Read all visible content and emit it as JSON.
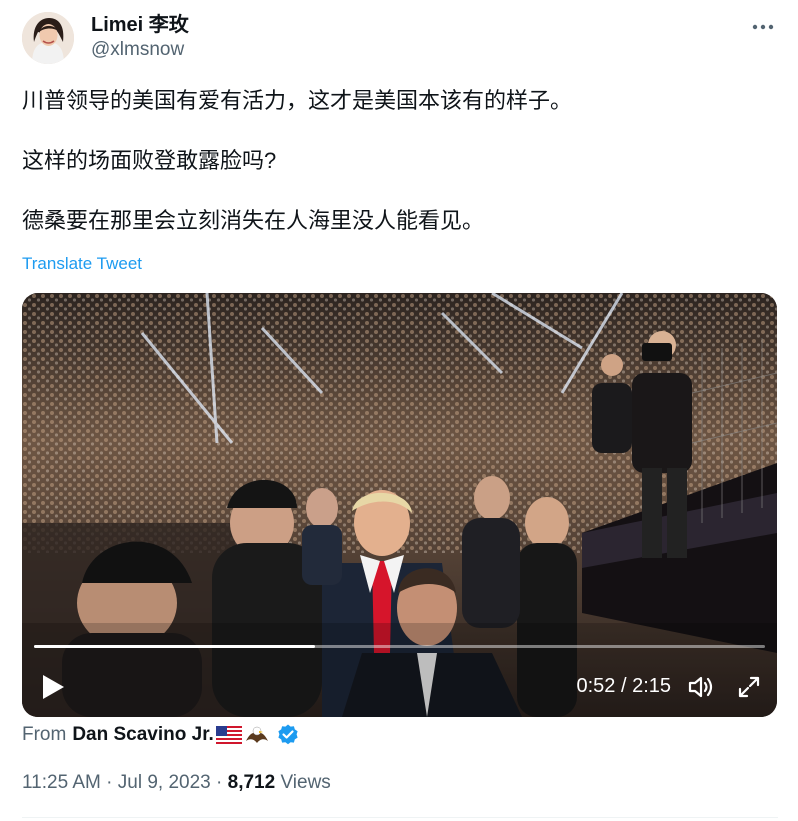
{
  "author": {
    "display_name": "Limei 李玫",
    "handle": "@xlmsnow"
  },
  "tweet": {
    "line1": "川普领导的美国有爱有活力，这才是美国本该有的样子。",
    "line2": "这样的场面败登敢露脸吗?",
    "line3": "德桑要在那里会立刻消失在人海里没人能看见。",
    "translate_label": "Translate Tweet"
  },
  "video": {
    "time": "0:52 / 2:15",
    "progress": 0.385
  },
  "source": {
    "from_label": "From",
    "name": "Dan Scavino Jr."
  },
  "meta": {
    "time": "11:25 AM",
    "separator": "·",
    "date": "Jul 9, 2023",
    "views_count": "8,712",
    "views_label": "Views"
  },
  "colors": {
    "link": "#1d9bf0",
    "secondary_text": "#536471",
    "verified": "#1d9bf0"
  },
  "icons": [
    "more-icon",
    "play-icon",
    "volume-icon",
    "fullscreen-icon",
    "verified-icon",
    "us-flag-icon",
    "eagle-icon"
  ]
}
